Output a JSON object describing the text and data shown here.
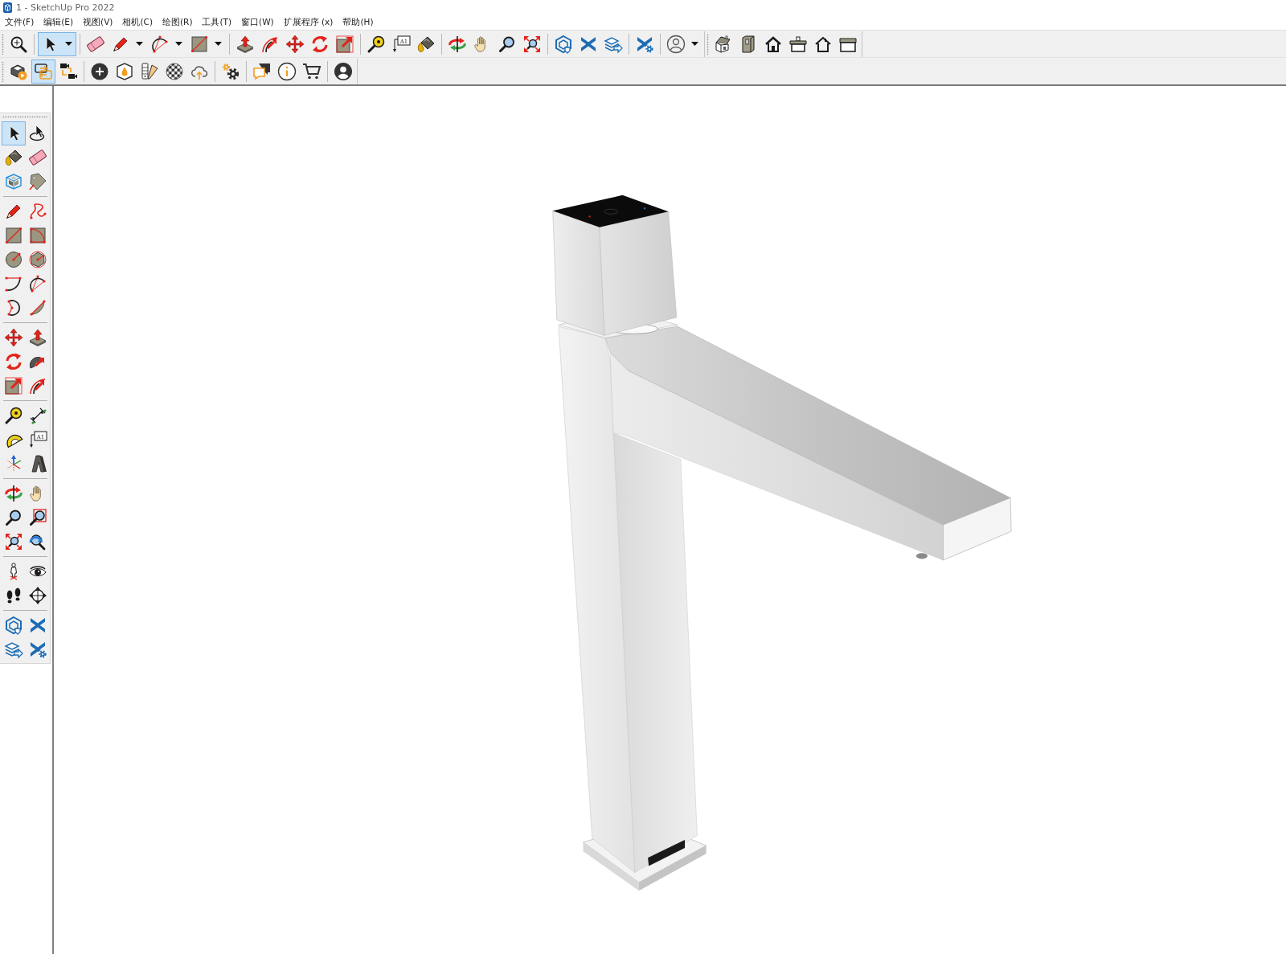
{
  "window": {
    "title": "1 - SketchUp Pro 2022"
  },
  "menu_bar": [
    "文件(F)",
    "编辑(E)",
    "视图(V)",
    "相机(C)",
    "绘图(R)",
    "工具(T)",
    "窗口(W)",
    "扩展程序 (x)",
    "帮助(H)"
  ],
  "toolbar_rows": [
    {
      "toolbars": [
        {
          "groups": [
            {
              "tools": [
                {
                  "kind": "search",
                  "selected": false
                }
              ]
            },
            {
              "tools": [
                {
                  "kind": "select",
                  "selected": true,
                  "dropdown": true
                }
              ]
            },
            {
              "tools": [
                {
                  "kind": "eraser",
                  "selected": false
                },
                {
                  "kind": "pencil",
                  "selected": false,
                  "dropdown": true
                },
                {
                  "kind": "arc",
                  "selected": false,
                  "dropdown": true
                },
                {
                  "kind": "rectangle",
                  "selected": false,
                  "dropdown": true
                }
              ]
            },
            {
              "tools": [
                {
                  "kind": "pushpull",
                  "selected": false
                },
                {
                  "kind": "offset",
                  "selected": false
                },
                {
                  "kind": "move",
                  "selected": false
                },
                {
                  "kind": "rotate",
                  "selected": false
                },
                {
                  "kind": "scale",
                  "selected": false
                }
              ]
            },
            {
              "tools": [
                {
                  "kind": "tape",
                  "selected": false
                },
                {
                  "kind": "text",
                  "selected": false,
                  "label": "A1"
                },
                {
                  "kind": "paint",
                  "selected": false
                }
              ]
            },
            {
              "tools": [
                {
                  "kind": "orbit",
                  "selected": false
                },
                {
                  "kind": "pan",
                  "selected": false
                },
                {
                  "kind": "zoom",
                  "selected": false
                },
                {
                  "kind": "zoom_extents",
                  "selected": false
                }
              ]
            },
            {
              "tools": [
                {
                  "kind": "warehouse",
                  "selected": false
                },
                {
                  "kind": "ext_warehouse",
                  "selected": false
                },
                {
                  "kind": "send_layout",
                  "selected": false
                }
              ]
            },
            {
              "tools": [
                {
                  "kind": "ext_manager",
                  "selected": false
                }
              ]
            },
            {
              "tools": [
                {
                  "kind": "account",
                  "selected": false,
                  "dropdown": true
                }
              ]
            }
          ]
        },
        {
          "groups": [
            {
              "tools": [
                {
                  "kind": "view_iso",
                  "selected": false
                },
                {
                  "kind": "view_top",
                  "selected": false
                },
                {
                  "kind": "view_front",
                  "selected": false
                },
                {
                  "kind": "view_right",
                  "selected": false
                },
                {
                  "kind": "view_back",
                  "selected": false
                },
                {
                  "kind": "view_left",
                  "selected": false
                }
              ]
            }
          ]
        }
      ]
    },
    {
      "toolbars": [
        {
          "groups": [
            {
              "tools": [
                {
                  "kind": "box_play",
                  "selected": false
                },
                {
                  "kind": "swap",
                  "selected": true
                },
                {
                  "kind": "cameras",
                  "selected": false
                }
              ]
            },
            {
              "tools": [
                {
                  "kind": "add",
                  "selected": false
                },
                {
                  "kind": "shield",
                  "selected": false
                },
                {
                  "kind": "color_fan",
                  "selected": false
                },
                {
                  "kind": "tiles",
                  "selected": false
                },
                {
                  "kind": "cloud_upload",
                  "selected": false
                }
              ]
            },
            {
              "tools": [
                {
                  "kind": "gears",
                  "selected": false
                }
              ]
            },
            {
              "tools": [
                {
                  "kind": "chat",
                  "selected": false
                },
                {
                  "kind": "info",
                  "selected": false
                },
                {
                  "kind": "cart",
                  "selected": false
                }
              ]
            },
            {
              "tools": [
                {
                  "kind": "profile",
                  "selected": false
                }
              ]
            }
          ]
        }
      ]
    }
  ],
  "tool_palette": {
    "groups": [
      {
        "tools": [
          {
            "kind": "select",
            "selected": true
          },
          {
            "kind": "lasso",
            "selected": false
          },
          {
            "kind": "paint",
            "selected": false
          },
          {
            "kind": "eraser",
            "selected": false
          },
          {
            "kind": "component",
            "selected": false
          },
          {
            "kind": "tag",
            "selected": false
          }
        ]
      },
      {
        "tools": [
          {
            "kind": "pencil",
            "selected": false
          },
          {
            "kind": "freehand",
            "selected": false
          },
          {
            "kind": "rectangle",
            "selected": false
          },
          {
            "kind": "rotated_rectangle",
            "selected": false
          },
          {
            "kind": "circle",
            "selected": false
          },
          {
            "kind": "polygon",
            "selected": false
          },
          {
            "kind": "arc2",
            "selected": false
          },
          {
            "kind": "arc",
            "selected": false
          },
          {
            "kind": "arc3",
            "selected": false
          },
          {
            "kind": "pie",
            "selected": false
          }
        ]
      },
      {
        "tools": [
          {
            "kind": "move",
            "selected": false
          },
          {
            "kind": "pushpull",
            "selected": false
          },
          {
            "kind": "rotate",
            "selected": false
          },
          {
            "kind": "followme",
            "selected": false
          },
          {
            "kind": "scale",
            "selected": false
          },
          {
            "kind": "offset",
            "selected": false
          }
        ]
      },
      {
        "tools": [
          {
            "kind": "tape",
            "selected": false
          },
          {
            "kind": "dimension",
            "selected": false
          },
          {
            "kind": "protractor",
            "selected": false
          },
          {
            "kind": "text",
            "selected": false,
            "label": "A1"
          },
          {
            "kind": "axes",
            "selected": false
          },
          {
            "kind": "text3d",
            "selected": false
          }
        ]
      },
      {
        "tools": [
          {
            "kind": "orbit",
            "selected": false
          },
          {
            "kind": "pan",
            "selected": false
          },
          {
            "kind": "zoom",
            "selected": false
          },
          {
            "kind": "zoom_window",
            "selected": false
          },
          {
            "kind": "zoom_extents",
            "selected": false
          },
          {
            "kind": "previous",
            "selected": false
          }
        ]
      },
      {
        "tools": [
          {
            "kind": "position_camera",
            "selected": false
          },
          {
            "kind": "look_around",
            "selected": false
          },
          {
            "kind": "walk",
            "selected": false
          },
          {
            "kind": "section",
            "selected": false
          }
        ]
      },
      {
        "tools": [
          {
            "kind": "warehouse",
            "selected": false
          },
          {
            "kind": "ext_warehouse",
            "selected": false
          },
          {
            "kind": "send_layout",
            "selected": false
          },
          {
            "kind": "ext_manager",
            "selected": false
          }
        ]
      }
    ]
  }
}
